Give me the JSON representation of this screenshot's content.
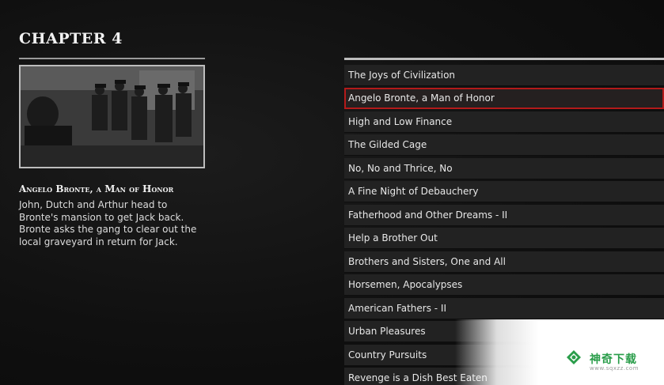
{
  "chapter": {
    "title": "CHAPTER 4"
  },
  "detail": {
    "title": "Angelo Bronte, a Man of Honor",
    "description": "John, Dutch and Arthur head to\nBronte's mansion to get Jack back.\nBronte asks the gang to clear out the\nlocal graveyard in return for Jack."
  },
  "missions": [
    {
      "label": "The Joys of Civilization",
      "selected": false
    },
    {
      "label": "Angelo Bronte, a Man of Honor",
      "selected": true
    },
    {
      "label": "High and Low Finance",
      "selected": false
    },
    {
      "label": "The Gilded Cage",
      "selected": false
    },
    {
      "label": "No, No and Thrice, No",
      "selected": false
    },
    {
      "label": "A Fine Night of Debauchery",
      "selected": false
    },
    {
      "label": "Fatherhood and Other Dreams - II",
      "selected": false
    },
    {
      "label": "Help a Brother Out",
      "selected": false
    },
    {
      "label": "Brothers and Sisters, One and All",
      "selected": false
    },
    {
      "label": "Horsemen, Apocalypses",
      "selected": false
    },
    {
      "label": "American Fathers - II",
      "selected": false
    },
    {
      "label": "Urban Pleasures",
      "selected": false
    },
    {
      "label": "Country Pursuits",
      "selected": false
    },
    {
      "label": "Revenge is a Dish Best Eaten",
      "selected": false
    }
  ],
  "watermark": {
    "title": "神奇下载",
    "url": "www.sqxzz.com"
  },
  "colors": {
    "selection": "#b31a1a",
    "row": "#222222",
    "watermark_green": "#2a9d4a"
  }
}
